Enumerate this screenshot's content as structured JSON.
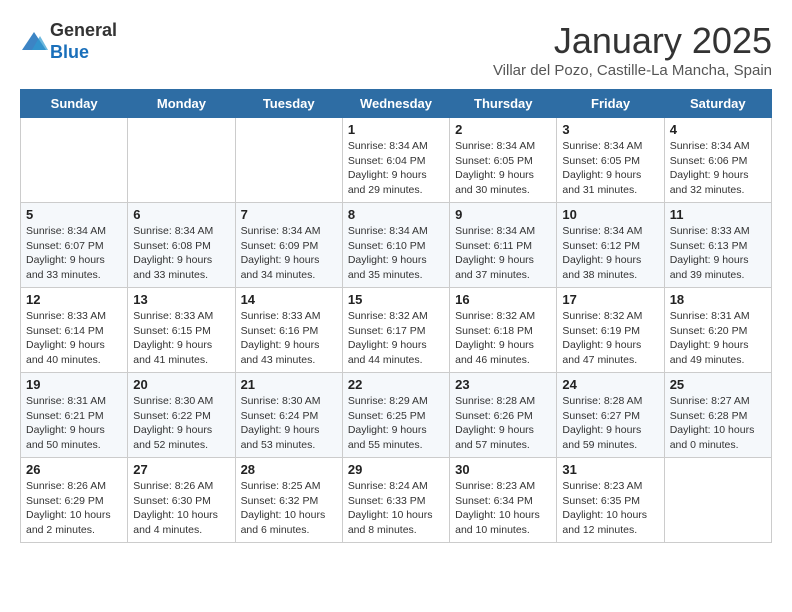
{
  "logo": {
    "general": "General",
    "blue": "Blue"
  },
  "header": {
    "month": "January 2025",
    "location": "Villar del Pozo, Castille-La Mancha, Spain"
  },
  "days_of_week": [
    "Sunday",
    "Monday",
    "Tuesday",
    "Wednesday",
    "Thursday",
    "Friday",
    "Saturday"
  ],
  "weeks": [
    [
      {
        "day": "",
        "info": ""
      },
      {
        "day": "",
        "info": ""
      },
      {
        "day": "",
        "info": ""
      },
      {
        "day": "1",
        "info": "Sunrise: 8:34 AM\nSunset: 6:04 PM\nDaylight: 9 hours and 29 minutes."
      },
      {
        "day": "2",
        "info": "Sunrise: 8:34 AM\nSunset: 6:05 PM\nDaylight: 9 hours and 30 minutes."
      },
      {
        "day": "3",
        "info": "Sunrise: 8:34 AM\nSunset: 6:05 PM\nDaylight: 9 hours and 31 minutes."
      },
      {
        "day": "4",
        "info": "Sunrise: 8:34 AM\nSunset: 6:06 PM\nDaylight: 9 hours and 32 minutes."
      }
    ],
    [
      {
        "day": "5",
        "info": "Sunrise: 8:34 AM\nSunset: 6:07 PM\nDaylight: 9 hours and 33 minutes."
      },
      {
        "day": "6",
        "info": "Sunrise: 8:34 AM\nSunset: 6:08 PM\nDaylight: 9 hours and 33 minutes."
      },
      {
        "day": "7",
        "info": "Sunrise: 8:34 AM\nSunset: 6:09 PM\nDaylight: 9 hours and 34 minutes."
      },
      {
        "day": "8",
        "info": "Sunrise: 8:34 AM\nSunset: 6:10 PM\nDaylight: 9 hours and 35 minutes."
      },
      {
        "day": "9",
        "info": "Sunrise: 8:34 AM\nSunset: 6:11 PM\nDaylight: 9 hours and 37 minutes."
      },
      {
        "day": "10",
        "info": "Sunrise: 8:34 AM\nSunset: 6:12 PM\nDaylight: 9 hours and 38 minutes."
      },
      {
        "day": "11",
        "info": "Sunrise: 8:33 AM\nSunset: 6:13 PM\nDaylight: 9 hours and 39 minutes."
      }
    ],
    [
      {
        "day": "12",
        "info": "Sunrise: 8:33 AM\nSunset: 6:14 PM\nDaylight: 9 hours and 40 minutes."
      },
      {
        "day": "13",
        "info": "Sunrise: 8:33 AM\nSunset: 6:15 PM\nDaylight: 9 hours and 41 minutes."
      },
      {
        "day": "14",
        "info": "Sunrise: 8:33 AM\nSunset: 6:16 PM\nDaylight: 9 hours and 43 minutes."
      },
      {
        "day": "15",
        "info": "Sunrise: 8:32 AM\nSunset: 6:17 PM\nDaylight: 9 hours and 44 minutes."
      },
      {
        "day": "16",
        "info": "Sunrise: 8:32 AM\nSunset: 6:18 PM\nDaylight: 9 hours and 46 minutes."
      },
      {
        "day": "17",
        "info": "Sunrise: 8:32 AM\nSunset: 6:19 PM\nDaylight: 9 hours and 47 minutes."
      },
      {
        "day": "18",
        "info": "Sunrise: 8:31 AM\nSunset: 6:20 PM\nDaylight: 9 hours and 49 minutes."
      }
    ],
    [
      {
        "day": "19",
        "info": "Sunrise: 8:31 AM\nSunset: 6:21 PM\nDaylight: 9 hours and 50 minutes."
      },
      {
        "day": "20",
        "info": "Sunrise: 8:30 AM\nSunset: 6:22 PM\nDaylight: 9 hours and 52 minutes."
      },
      {
        "day": "21",
        "info": "Sunrise: 8:30 AM\nSunset: 6:24 PM\nDaylight: 9 hours and 53 minutes."
      },
      {
        "day": "22",
        "info": "Sunrise: 8:29 AM\nSunset: 6:25 PM\nDaylight: 9 hours and 55 minutes."
      },
      {
        "day": "23",
        "info": "Sunrise: 8:28 AM\nSunset: 6:26 PM\nDaylight: 9 hours and 57 minutes."
      },
      {
        "day": "24",
        "info": "Sunrise: 8:28 AM\nSunset: 6:27 PM\nDaylight: 9 hours and 59 minutes."
      },
      {
        "day": "25",
        "info": "Sunrise: 8:27 AM\nSunset: 6:28 PM\nDaylight: 10 hours and 0 minutes."
      }
    ],
    [
      {
        "day": "26",
        "info": "Sunrise: 8:26 AM\nSunset: 6:29 PM\nDaylight: 10 hours and 2 minutes."
      },
      {
        "day": "27",
        "info": "Sunrise: 8:26 AM\nSunset: 6:30 PM\nDaylight: 10 hours and 4 minutes."
      },
      {
        "day": "28",
        "info": "Sunrise: 8:25 AM\nSunset: 6:32 PM\nDaylight: 10 hours and 6 minutes."
      },
      {
        "day": "29",
        "info": "Sunrise: 8:24 AM\nSunset: 6:33 PM\nDaylight: 10 hours and 8 minutes."
      },
      {
        "day": "30",
        "info": "Sunrise: 8:23 AM\nSunset: 6:34 PM\nDaylight: 10 hours and 10 minutes."
      },
      {
        "day": "31",
        "info": "Sunrise: 8:23 AM\nSunset: 6:35 PM\nDaylight: 10 hours and 12 minutes."
      },
      {
        "day": "",
        "info": ""
      }
    ]
  ]
}
